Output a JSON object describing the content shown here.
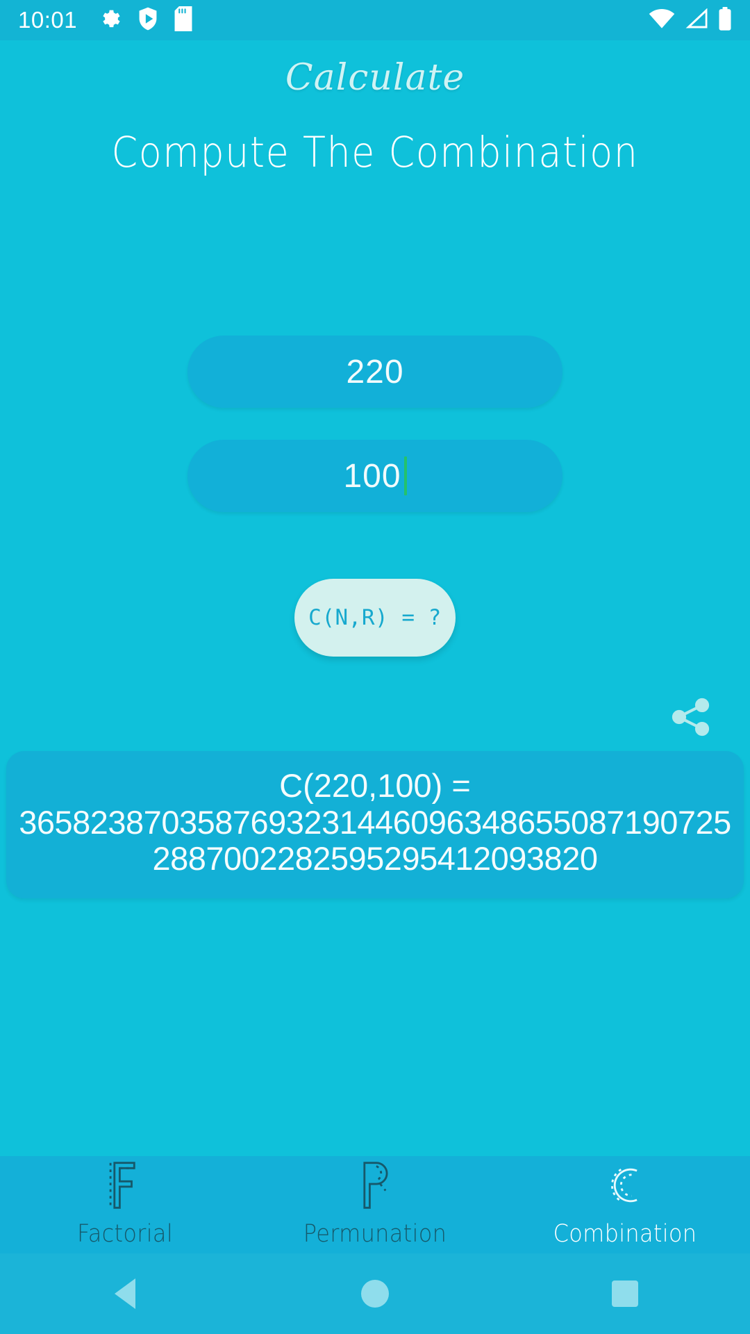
{
  "status_bar": {
    "clock": "10:01",
    "left_icons": [
      "gear-icon",
      "shield-play-icon",
      "sd-card-icon"
    ],
    "right_icons": [
      "wifi-icon",
      "cell-signal-icon",
      "battery-icon"
    ],
    "background_color": "#13B4D4"
  },
  "header": {
    "app_title": "Calculate",
    "subtitle": "Compute The Combination",
    "title_color": "#CFF3F4",
    "subtitle_color": "#FFFFFF"
  },
  "form": {
    "n_input": {
      "value": "220",
      "placeholder": "N",
      "focused": false
    },
    "r_input": {
      "value": "100",
      "placeholder": "R",
      "focused": true,
      "caret_color": "#24C26B"
    },
    "compute_button": {
      "label": "C(N,R) = ?",
      "background_color": "#D3F1EE",
      "text_color": "#17A9CE"
    }
  },
  "actions": {
    "share_icon": "share-icon",
    "share_icon_color": "#B4EAEC"
  },
  "result": {
    "equation": "C(220,100) =",
    "value": "36582387035876932314460963486550871907252887002282595295412093820",
    "background_color": "#13B0D6",
    "text_color": "#F4FCFD"
  },
  "bottom_nav": {
    "items": [
      {
        "label": "Factorial",
        "glyph": "letter-f-outline-icon",
        "active": false
      },
      {
        "label": "Permunation",
        "glyph": "letter-p-outline-icon",
        "active": false
      },
      {
        "label": "Combination",
        "glyph": "letter-c-outline-icon",
        "active": true
      }
    ],
    "inactive_color": "#16596B",
    "active_color": "#FFFFFF",
    "background_color": "#14B0D8"
  },
  "system_nav": {
    "back": "back-triangle-icon",
    "home": "home-circle-icon",
    "recents": "recents-square-icon",
    "tint": "#8FDDEC"
  },
  "theme": {
    "page_background": "#0FC1DA",
    "field_background": "#12B0D8",
    "accent": "#17A9CE"
  }
}
